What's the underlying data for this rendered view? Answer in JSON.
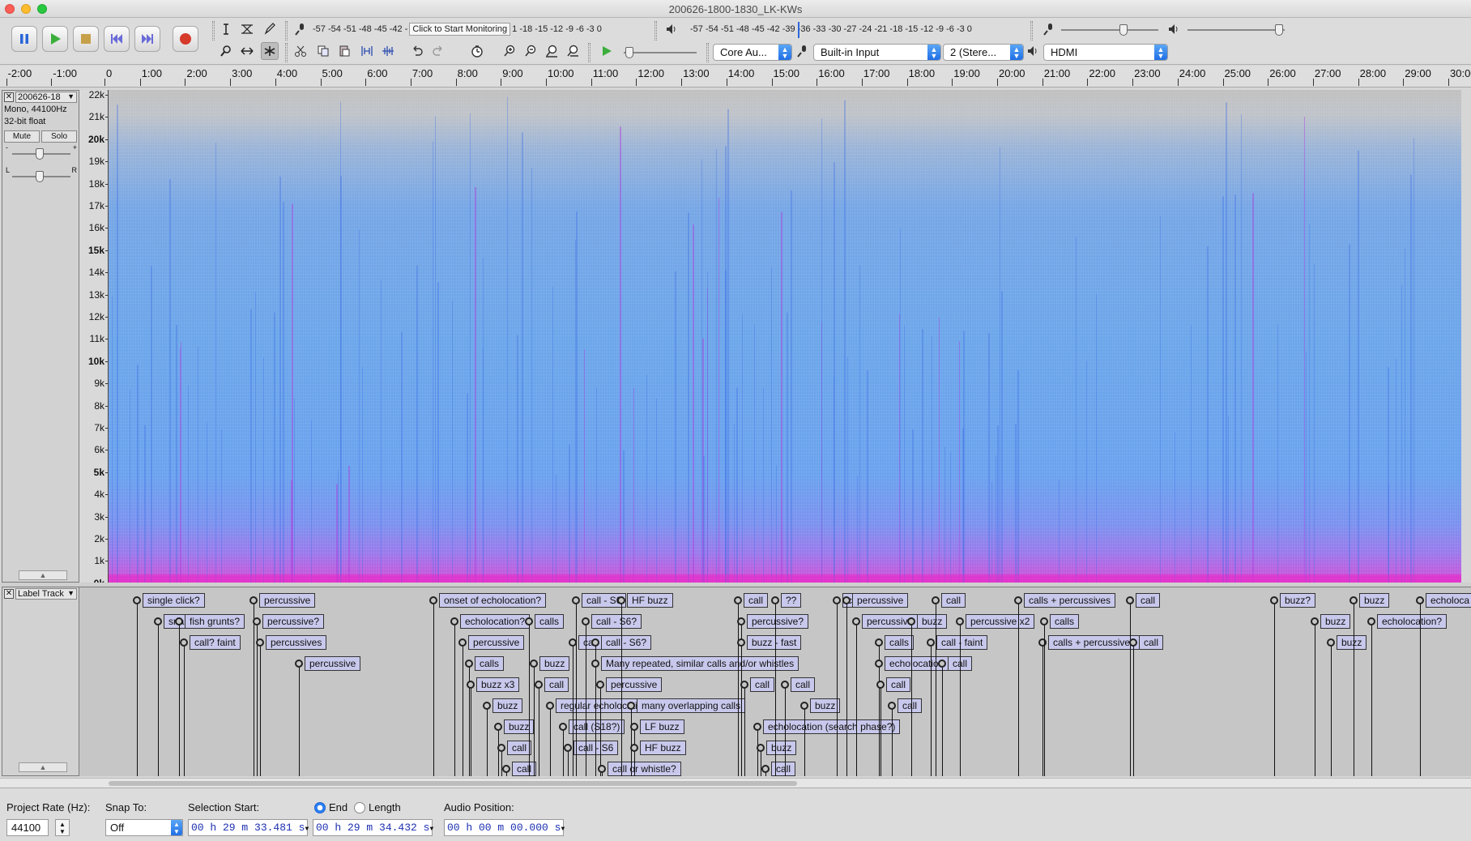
{
  "window": {
    "title": "200626-1800-1830_LK-KWs"
  },
  "toolbar": {
    "record_meter_scale": "-57 -54 -51 -48 -45 -42 -",
    "monitor_button": "Click to Start Monitoring",
    "record_meter_scale_right": "1 -18 -15 -12  -9   -6   -3   0",
    "play_meter_scale": "-57 -54 -51 -48 -45 -42 -39 -36 -33 -30 -27 -24 -21 -18 -15 -12  -9   -6   -3   0",
    "host": "Core Au...",
    "recording_device": "Built-in Input",
    "channels": "2 (Stere...",
    "playback_device": "HDMI"
  },
  "ruler": {
    "ticks": [
      "-2:00",
      "-1:00",
      "0",
      "1:00",
      "2:00",
      "3:00",
      "4:00",
      "5:00",
      "6:00",
      "7:00",
      "8:00",
      "9:00",
      "10:00",
      "11:00",
      "12:00",
      "13:00",
      "14:00",
      "15:00",
      "16:00",
      "17:00",
      "18:00",
      "19:00",
      "20:00",
      "21:00",
      "22:00",
      "23:00",
      "24:00",
      "25:00",
      "26:00",
      "27:00",
      "28:00",
      "29:00",
      "30:00"
    ]
  },
  "audio_track": {
    "name": "200626-18",
    "info_line1": "Mono, 44100Hz",
    "info_line2": "32-bit float",
    "mute": "Mute",
    "solo": "Solo",
    "gain_minus": "-",
    "gain_plus": "+",
    "pan_left": "L",
    "pan_right": "R"
  },
  "freq_axis": [
    "22k",
    "21k",
    "20k",
    "19k",
    "18k",
    "17k",
    "16k",
    "15k",
    "14k",
    "13k",
    "12k",
    "11k",
    "10k",
    "9k",
    "8k",
    "7k",
    "6k",
    "5k",
    "4k",
    "3k",
    "2k",
    "1k",
    "0k"
  ],
  "label_track": {
    "name": "Label Track",
    "labels": [
      {
        "text": "single click?",
        "row": 0
      },
      {
        "text": "snap",
        "row": 1
      },
      {
        "text": "fish grunts?",
        "row": 1
      },
      {
        "text": "call? faint",
        "row": 2
      },
      {
        "text": "percussive",
        "row": 0
      },
      {
        "text": "percussive?",
        "row": 1
      },
      {
        "text": "percussives",
        "row": 2
      },
      {
        "text": "percussive",
        "row": 3
      },
      {
        "text": "onset of echolocation?",
        "row": 0
      },
      {
        "text": "echolocation?",
        "row": 1
      },
      {
        "text": "percussive",
        "row": 2
      },
      {
        "text": "calls",
        "row": 3
      },
      {
        "text": "buzz x3",
        "row": 4
      },
      {
        "text": "buzz",
        "row": 5
      },
      {
        "text": "buzz",
        "row": 6
      },
      {
        "text": "call",
        "row": 7
      },
      {
        "text": "call",
        "row": 8
      },
      {
        "text": "calls",
        "row": 1
      },
      {
        "text": "buzz",
        "row": 3
      },
      {
        "text": "call",
        "row": 4
      },
      {
        "text": "regular echolocation",
        "row": 5
      },
      {
        "text": "call (S18?)",
        "row": 6
      },
      {
        "text": "call - S6",
        "row": 7
      },
      {
        "text": "call",
        "row": 2
      },
      {
        "text": "call - S6",
        "row": 0
      },
      {
        "text": "call - S6?",
        "row": 1
      },
      {
        "text": "call - S6?",
        "row": 2
      },
      {
        "text": "Many repeated, similar calls and/or whistles",
        "row": 3
      },
      {
        "text": "percussive",
        "row": 4
      },
      {
        "text": "call or whistle?",
        "row": 8
      },
      {
        "text": "HF buzz",
        "row": 0
      },
      {
        "text": "many overlapping calls",
        "row": 5
      },
      {
        "text": "LF buzz",
        "row": 6
      },
      {
        "text": "HF buzz",
        "row": 7
      },
      {
        "text": "call",
        "row": 0
      },
      {
        "text": "percussive?",
        "row": 1
      },
      {
        "text": "buzz - fast",
        "row": 2
      },
      {
        "text": "call",
        "row": 4
      },
      {
        "text": "echolocation (search phase?)",
        "row": 6
      },
      {
        "text": "buzz",
        "row": 7
      },
      {
        "text": "call",
        "row": 8
      },
      {
        "text": "??",
        "row": 0
      },
      {
        "text": "call",
        "row": 4
      },
      {
        "text": "buzz",
        "row": 5
      },
      {
        "text": "call",
        "row": 0
      },
      {
        "text": "percussive",
        "row": 0
      },
      {
        "text": "percussive",
        "row": 1
      },
      {
        "text": "calls",
        "row": 2
      },
      {
        "text": "echolocation",
        "row": 3
      },
      {
        "text": "call",
        "row": 4
      },
      {
        "text": "call",
        "row": 5
      },
      {
        "text": "buzz",
        "row": 1
      },
      {
        "text": "call - faint",
        "row": 2
      },
      {
        "text": "call",
        "row": 0
      },
      {
        "text": "call",
        "row": 3
      },
      {
        "text": "percussive x2",
        "row": 1
      },
      {
        "text": "calls + percussives",
        "row": 0
      },
      {
        "text": "calls + percussives",
        "row": 2
      },
      {
        "text": "calls",
        "row": 1
      },
      {
        "text": "call",
        "row": 0
      },
      {
        "text": "call",
        "row": 2
      },
      {
        "text": "buzz?",
        "row": 0
      },
      {
        "text": "buzz",
        "row": 1
      },
      {
        "text": "buzz",
        "row": 2
      },
      {
        "text": "buzz",
        "row": 0
      },
      {
        "text": "echolocation?",
        "row": 1
      },
      {
        "text": "echoloca",
        "row": 0
      }
    ]
  },
  "selection_bar": {
    "project_rate_label": "Project Rate (Hz):",
    "project_rate": "44100",
    "snap_to_label": "Snap To:",
    "snap_to": "Off",
    "selection_start_label": "Selection Start:",
    "end_label": "End",
    "length_label": "Length",
    "selection_start": "00 h 29 m 33.481 s",
    "selection_end": "00 h 29 m 34.432 s",
    "audio_position_label": "Audio Position:",
    "audio_position": "00 h 00 m 00.000 s"
  }
}
